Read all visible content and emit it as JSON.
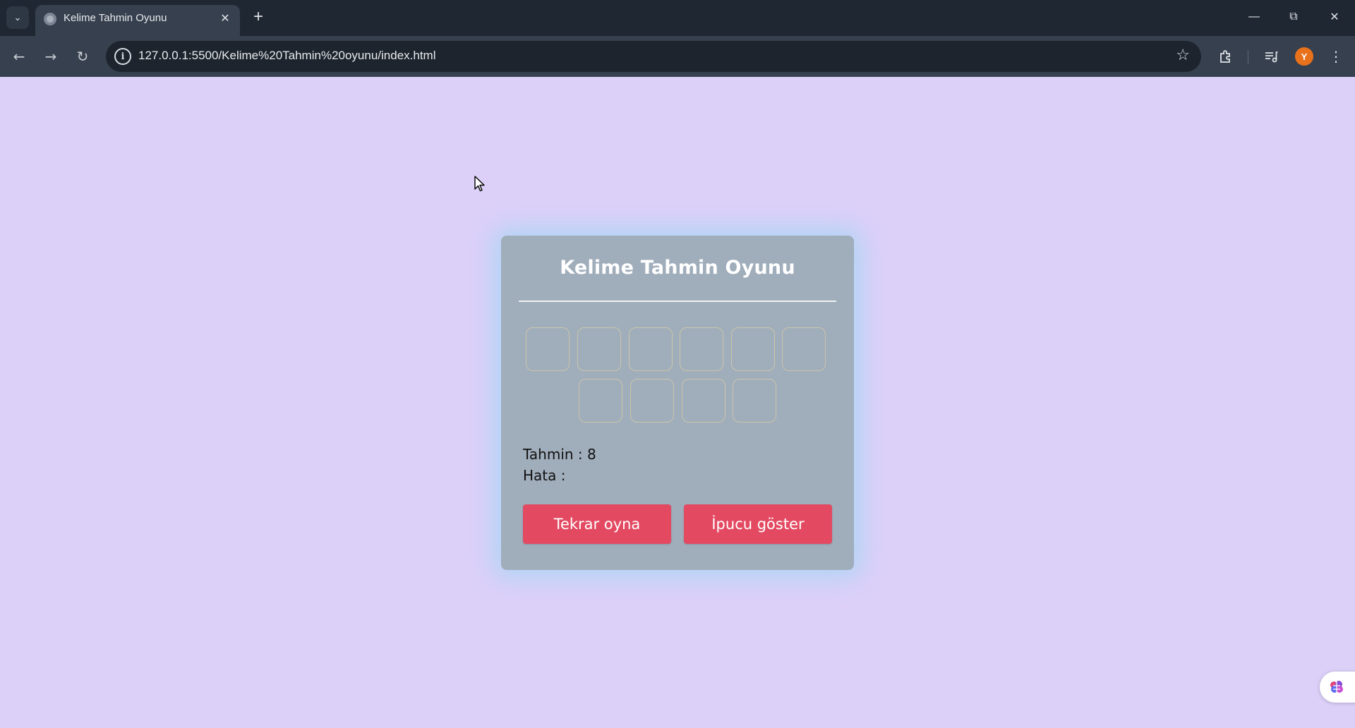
{
  "browser": {
    "tab_title": "Kelime Tahmin Oyunu",
    "url": "127.0.0.1:5500/Kelime%20Tahmin%20oyunu/index.html",
    "profile_initial": "Y"
  },
  "game": {
    "title": "Kelime Tahmin Oyunu",
    "letters_row1": [
      "",
      "",
      "",
      "",
      "",
      ""
    ],
    "letters_row2": [
      "",
      "",
      "",
      ""
    ],
    "guess_label": "Tahmin : 8",
    "error_label": "Hata :",
    "restart_label": "Tekrar oyna",
    "hint_label": "İpucu göster"
  },
  "colors": {
    "page_background": "#dcd0f8",
    "card_background": "#a0adbb",
    "button": "#e34a62",
    "card_glow": "#78dcf5"
  },
  "icons": [
    "tab-search-icon",
    "favicon-icon",
    "close-icon",
    "plus-icon",
    "minimize-icon",
    "restore-icon",
    "back-icon",
    "forward-icon",
    "reload-icon",
    "site-info-icon",
    "star-icon",
    "extensions-icon",
    "media-icon",
    "menu-icon",
    "cursor-icon",
    "brain-icon"
  ]
}
